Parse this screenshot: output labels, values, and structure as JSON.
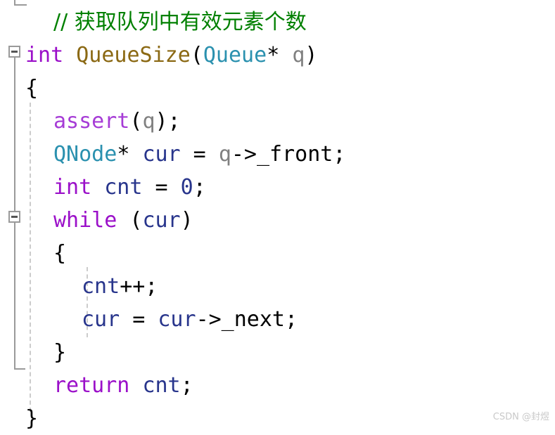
{
  "editor": {
    "language": "C",
    "background_color": "#ffffff",
    "font_size_px": 30,
    "line_height_px": 47,
    "colors": {
      "comment": "#008000",
      "keyword": "#9B10C9",
      "macro": "#A63CD6",
      "type": "#2B91AF",
      "function": "#8B6914",
      "identifier": "#28358C",
      "parameter": "#808080",
      "plain": "#000000",
      "fold_bar": "#9a9a9a",
      "indent_guide": "#cccccc",
      "watermark": "#c9c9c9"
    }
  },
  "code": {
    "lines": [
      {
        "n": 1,
        "indent": 1,
        "tokens": [
          {
            "t": "comment",
            "s": "// 获取队列中有效元素个数",
            "cjk": true
          }
        ]
      },
      {
        "n": 2,
        "indent": 0,
        "fold": "open",
        "tokens": [
          {
            "t": "keyword",
            "s": "int"
          },
          {
            "t": "plain",
            "s": " "
          },
          {
            "t": "func",
            "s": "QueueSize"
          },
          {
            "t": "plain",
            "s": "("
          },
          {
            "t": "type",
            "s": "Queue"
          },
          {
            "t": "plain",
            "s": "* "
          },
          {
            "t": "param",
            "s": "q"
          },
          {
            "t": "plain",
            "s": ")"
          }
        ]
      },
      {
        "n": 3,
        "indent": 0,
        "tokens": [
          {
            "t": "plain",
            "s": "{"
          }
        ]
      },
      {
        "n": 4,
        "indent": 1,
        "tokens": [
          {
            "t": "macro",
            "s": "assert"
          },
          {
            "t": "plain",
            "s": "("
          },
          {
            "t": "param",
            "s": "q"
          },
          {
            "t": "plain",
            "s": ");"
          }
        ]
      },
      {
        "n": 5,
        "indent": 1,
        "tokens": [
          {
            "t": "type",
            "s": "QNode"
          },
          {
            "t": "plain",
            "s": "* "
          },
          {
            "t": "ident",
            "s": "cur"
          },
          {
            "t": "plain",
            "s": " = "
          },
          {
            "t": "param",
            "s": "q"
          },
          {
            "t": "plain",
            "s": "->_front;"
          }
        ]
      },
      {
        "n": 6,
        "indent": 1,
        "tokens": [
          {
            "t": "keyword",
            "s": "int"
          },
          {
            "t": "plain",
            "s": " "
          },
          {
            "t": "ident",
            "s": "cnt"
          },
          {
            "t": "plain",
            "s": " = "
          },
          {
            "t": "num",
            "s": "0"
          },
          {
            "t": "plain",
            "s": ";"
          }
        ]
      },
      {
        "n": 7,
        "indent": 1,
        "fold": "open",
        "tokens": [
          {
            "t": "keyword",
            "s": "while"
          },
          {
            "t": "plain",
            "s": " ("
          },
          {
            "t": "ident",
            "s": "cur"
          },
          {
            "t": "plain",
            "s": ")"
          }
        ]
      },
      {
        "n": 8,
        "indent": 1,
        "tokens": [
          {
            "t": "plain",
            "s": "{"
          }
        ]
      },
      {
        "n": 9,
        "indent": 2,
        "tokens": [
          {
            "t": "ident",
            "s": "cnt"
          },
          {
            "t": "plain",
            "s": "++;"
          }
        ]
      },
      {
        "n": 10,
        "indent": 2,
        "tokens": [
          {
            "t": "ident",
            "s": "cur"
          },
          {
            "t": "plain",
            "s": " = "
          },
          {
            "t": "ident",
            "s": "cur"
          },
          {
            "t": "plain",
            "s": "->_next;"
          }
        ]
      },
      {
        "n": 11,
        "indent": 1,
        "tokens": [
          {
            "t": "plain",
            "s": "}"
          }
        ]
      },
      {
        "n": 12,
        "indent": 1,
        "tokens": [
          {
            "t": "keyword",
            "s": "return"
          },
          {
            "t": "plain",
            "s": " "
          },
          {
            "t": "ident",
            "s": "cnt"
          },
          {
            "t": "plain",
            "s": ";"
          }
        ]
      },
      {
        "n": 13,
        "indent": 0,
        "tokens": [
          {
            "t": "plain",
            "s": "}"
          }
        ]
      }
    ]
  },
  "watermark": {
    "text": "CSDN @封煜"
  }
}
